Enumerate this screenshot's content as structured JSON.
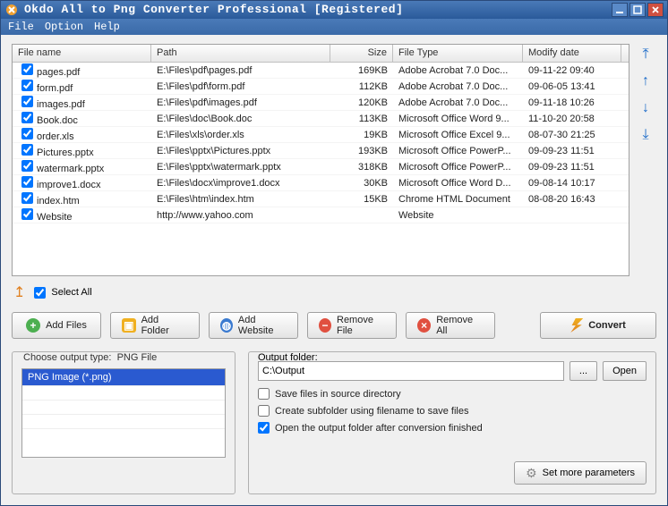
{
  "title": "Okdo All to Png Converter Professional [Registered]",
  "menu": {
    "file": "File",
    "option": "Option",
    "help": "Help"
  },
  "columns": {
    "name": "File name",
    "path": "Path",
    "size": "Size",
    "type": "File Type",
    "date": "Modify date"
  },
  "files": [
    {
      "name": "pages.pdf",
      "path": "E:\\Files\\pdf\\pages.pdf",
      "size": "169KB",
      "type": "Adobe Acrobat 7.0 Doc...",
      "date": "09-11-22 09:40"
    },
    {
      "name": "form.pdf",
      "path": "E:\\Files\\pdf\\form.pdf",
      "size": "112KB",
      "type": "Adobe Acrobat 7.0 Doc...",
      "date": "09-06-05 13:41"
    },
    {
      "name": "images.pdf",
      "path": "E:\\Files\\pdf\\images.pdf",
      "size": "120KB",
      "type": "Adobe Acrobat 7.0 Doc...",
      "date": "09-11-18 10:26"
    },
    {
      "name": "Book.doc",
      "path": "E:\\Files\\doc\\Book.doc",
      "size": "113KB",
      "type": "Microsoft Office Word 9...",
      "date": "11-10-20 20:58"
    },
    {
      "name": "order.xls",
      "path": "E:\\Files\\xls\\order.xls",
      "size": "19KB",
      "type": "Microsoft Office Excel 9...",
      "date": "08-07-30 21:25"
    },
    {
      "name": "Pictures.pptx",
      "path": "E:\\Files\\pptx\\Pictures.pptx",
      "size": "193KB",
      "type": "Microsoft Office PowerP...",
      "date": "09-09-23 11:51"
    },
    {
      "name": "watermark.pptx",
      "path": "E:\\Files\\pptx\\watermark.pptx",
      "size": "318KB",
      "type": "Microsoft Office PowerP...",
      "date": "09-09-23 11:51"
    },
    {
      "name": "improve1.docx",
      "path": "E:\\Files\\docx\\improve1.docx",
      "size": "30KB",
      "type": "Microsoft Office Word D...",
      "date": "09-08-14 10:17"
    },
    {
      "name": "index.htm",
      "path": "E:\\Files\\htm\\index.htm",
      "size": "15KB",
      "type": "Chrome HTML Document",
      "date": "08-08-20 16:43"
    },
    {
      "name": "Website",
      "path": "http://www.yahoo.com",
      "size": "",
      "type": "Website",
      "date": ""
    }
  ],
  "selectAll": "Select All",
  "buttons": {
    "addFiles": "Add Files",
    "addFolder": "Add Folder",
    "addWebsite": "Add Website",
    "removeFile": "Remove File",
    "removeAll": "Remove All",
    "convert": "Convert"
  },
  "outputType": {
    "label": "Choose output type:",
    "current": "PNG File",
    "option": "PNG Image (*.png)"
  },
  "outputFolder": {
    "label": "Output folder:",
    "value": "C:\\Output",
    "browse": "...",
    "open": "Open"
  },
  "options": {
    "saveInSource": "Save files in source directory",
    "createSubfolder": "Create subfolder using filename to save files",
    "openAfter": "Open the output folder after conversion finished",
    "more": "Set more parameters"
  }
}
